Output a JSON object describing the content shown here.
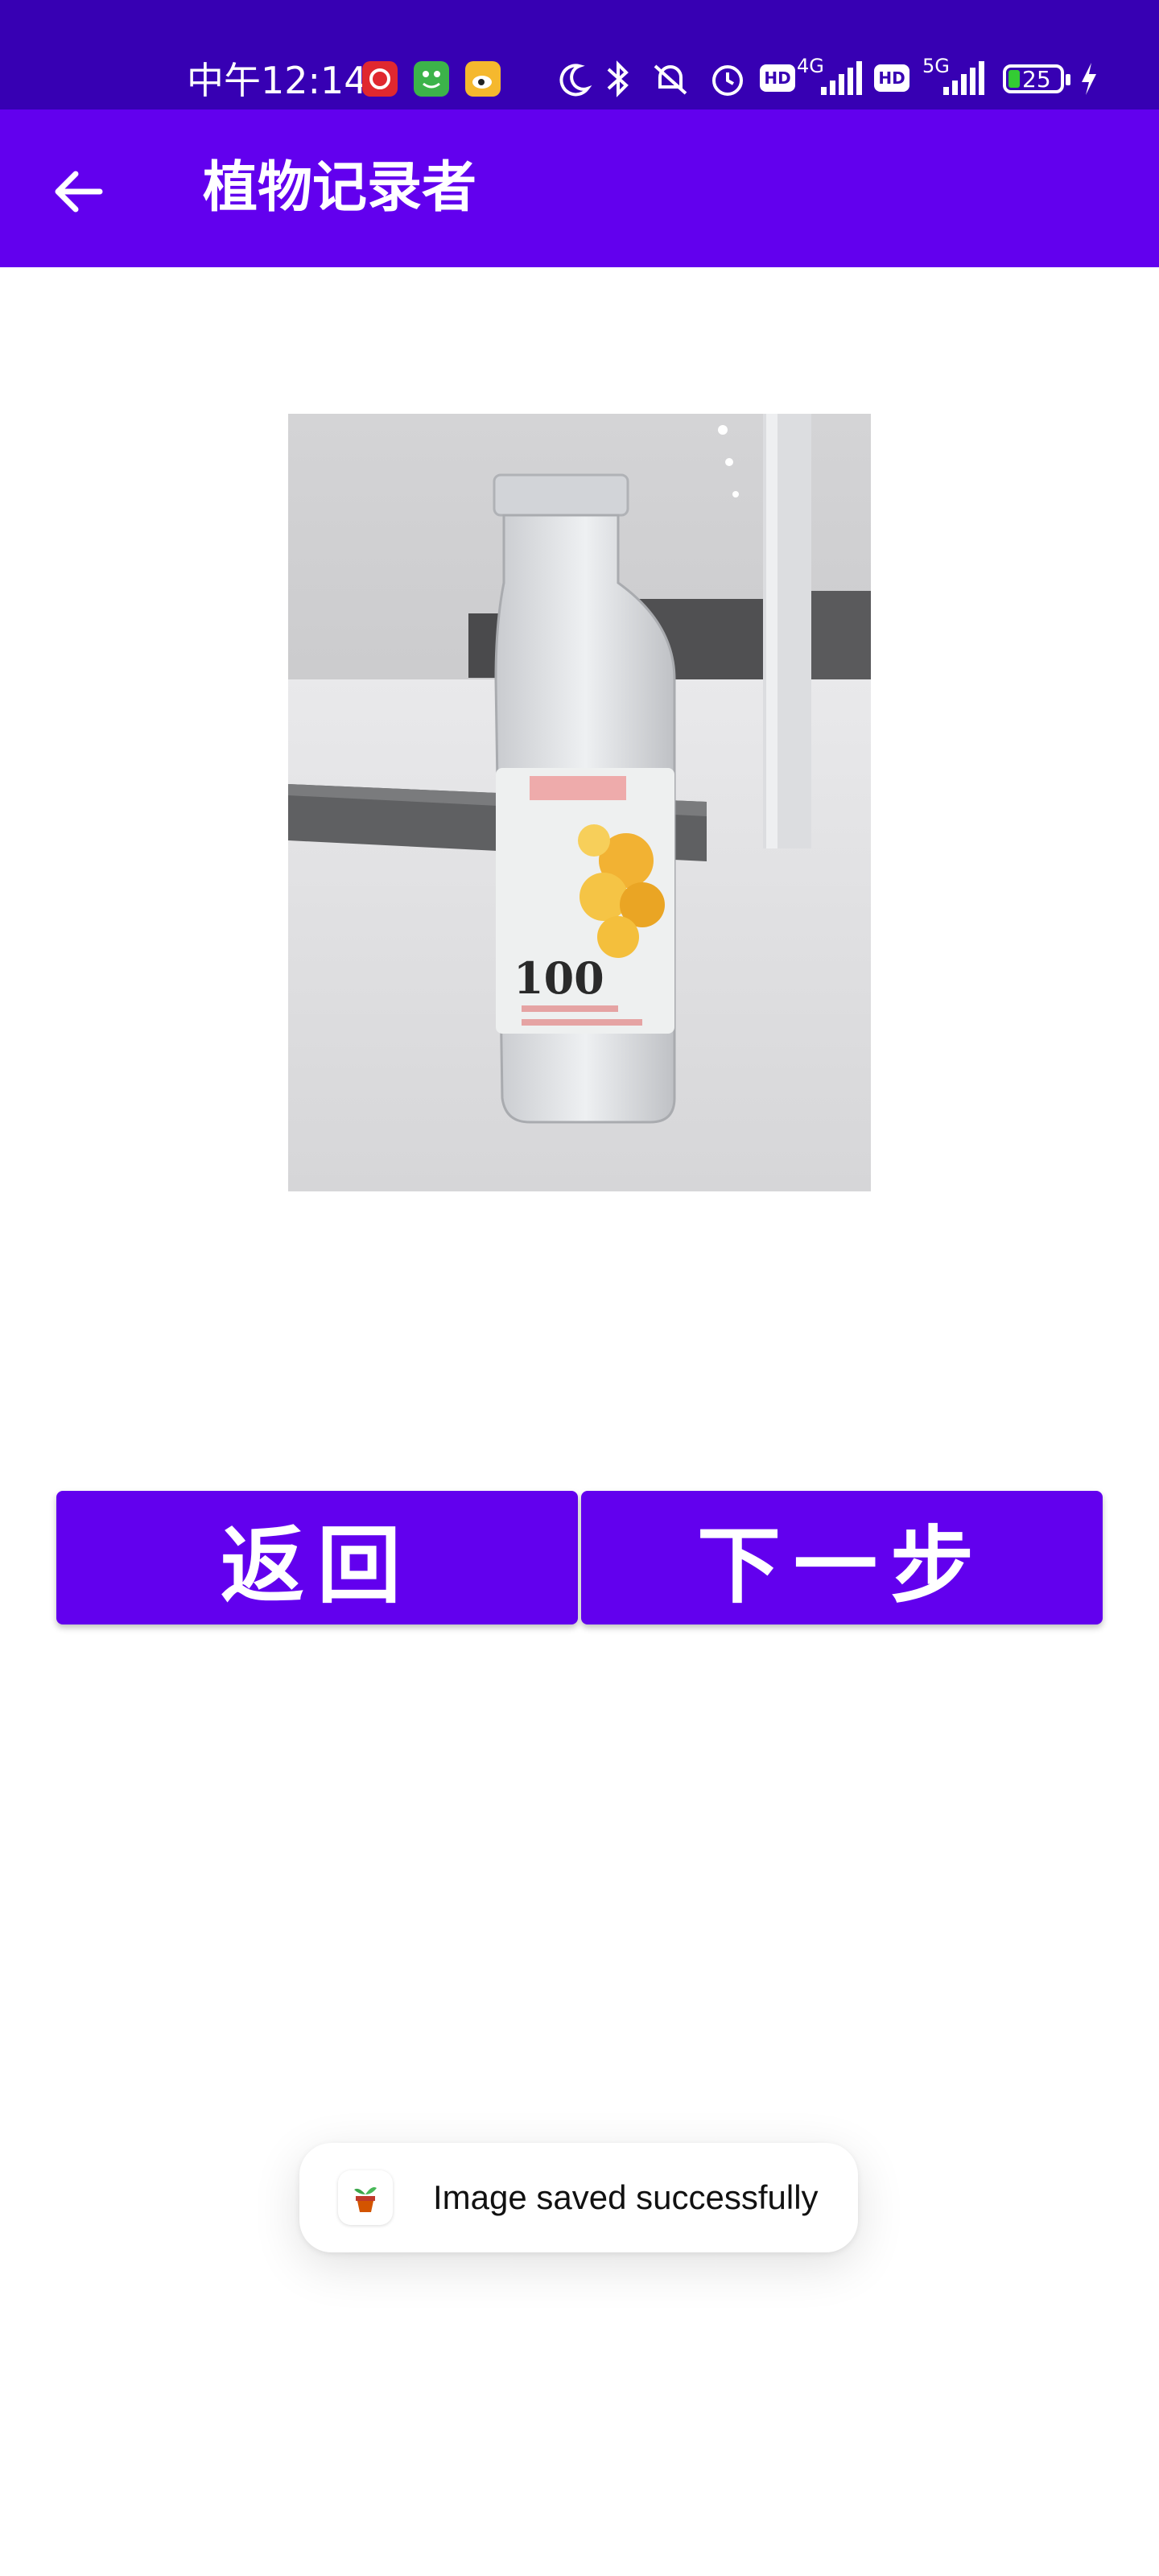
{
  "status_bar": {
    "time": "中午12:14",
    "battery_level": "25",
    "network_1": "4G",
    "network_2": "5G",
    "hd_label": "HD",
    "colors": {
      "background": "#3700b3",
      "battery": "#33cc33"
    }
  },
  "app_bar": {
    "title": "植物记录者",
    "back_icon": "arrow-left-icon",
    "color": "#6200ee"
  },
  "photo": {
    "bottle_brand": "100"
  },
  "buttons": {
    "back_label": "返回",
    "next_label": "下一步"
  },
  "toast": {
    "message": "Image saved successfully",
    "icon": "plant-pot-icon"
  }
}
